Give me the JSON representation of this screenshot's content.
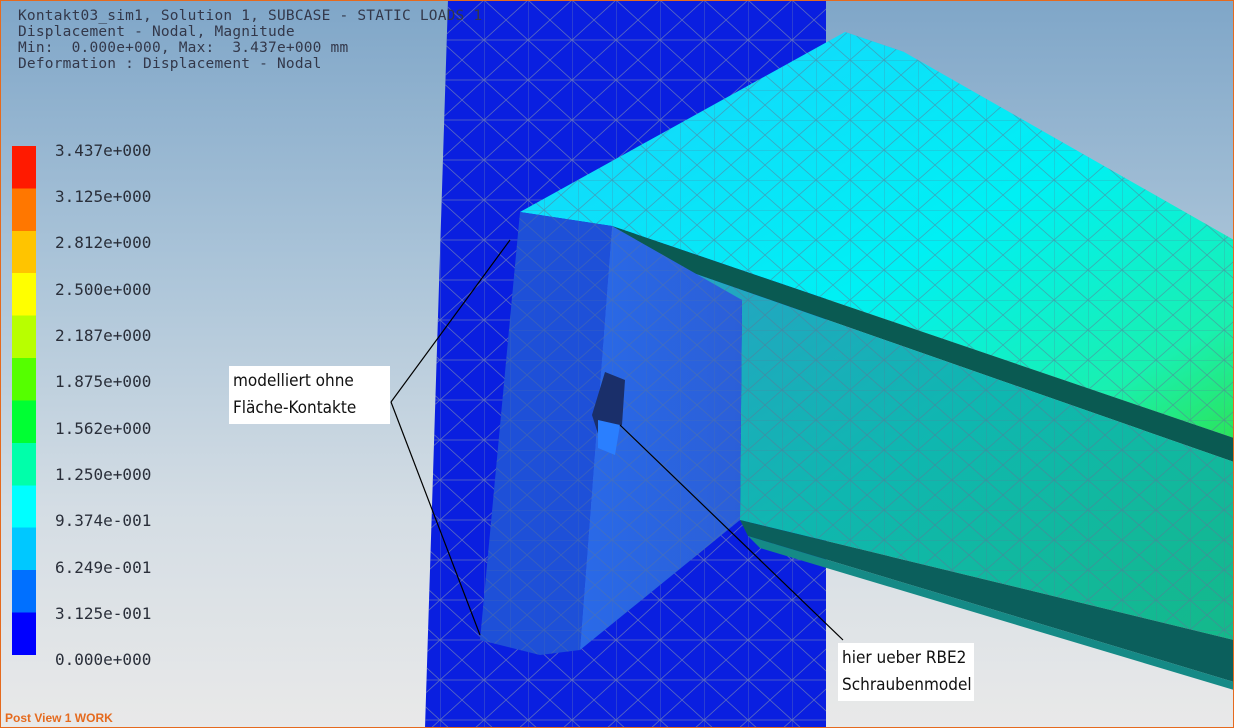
{
  "header": {
    "line1": "Kontakt03_sim1, Solution 1, SUBCASE - STATIC LOADS 1",
    "line2": "Displacement - Nodal, Magnitude",
    "line3": "Min:  0.000e+000, Max:  3.437e+000 mm",
    "line4": "Deformation : Displacement - Nodal"
  },
  "legend": {
    "ticks": [
      "3.437e+000",
      "3.125e+000",
      "2.812e+000",
      "2.500e+000",
      "2.187e+000",
      "1.875e+000",
      "1.562e+000",
      "1.250e+000",
      "9.374e-001",
      "6.249e-001",
      "3.125e-001",
      "0.000e+000"
    ],
    "colors": [
      "#ff1a00",
      "#ff7700",
      "#ffc400",
      "#ffff00",
      "#b8ff00",
      "#55ff00",
      "#00ff33",
      "#00ffaa",
      "#00ffff",
      "#00c8ff",
      "#0070ff",
      "#0000ff"
    ]
  },
  "callouts": {
    "left": {
      "line1": "modelliert ohne",
      "line2": "Fläche-Kontakte"
    },
    "right": {
      "line1": "hier ueber RBE2",
      "line2": "Schraubenmodel"
    }
  },
  "status": "Post View  1 WORK",
  "colors": {
    "frame": "#e56a1e",
    "column": "#0a1fe0",
    "beam_top": "#00eaff",
    "beam_web": "#0fbfb0",
    "plate": "#2a6be0"
  }
}
